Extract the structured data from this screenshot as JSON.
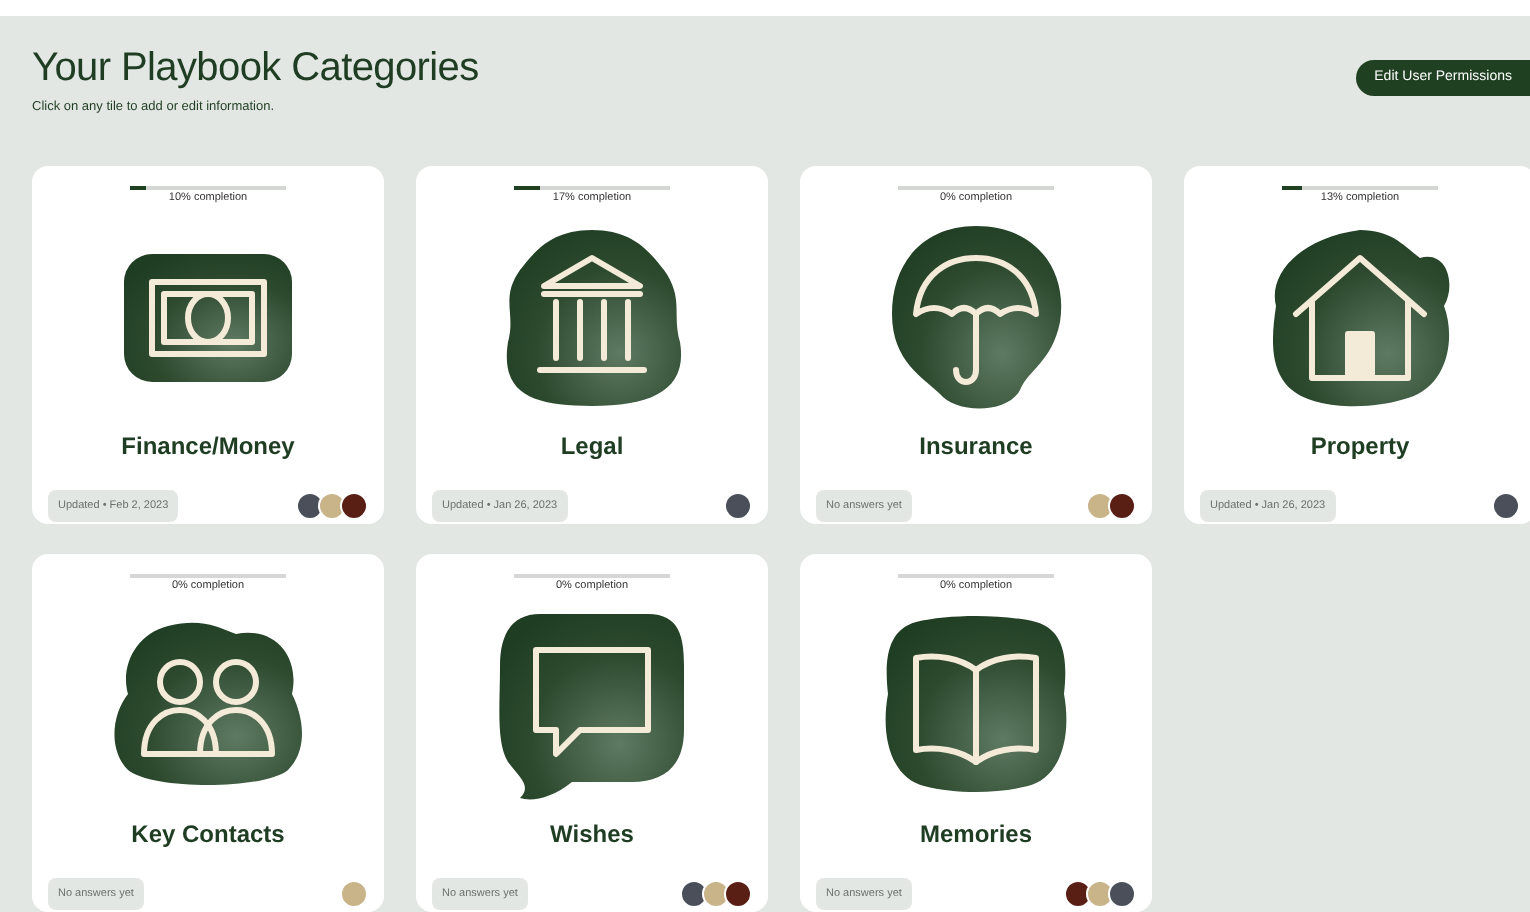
{
  "header": {
    "title": "Your Playbook Categories",
    "subtitle": "Click on any tile to add or edit information.",
    "button": "Edit User Permissions"
  },
  "categories": [
    {
      "kind": "money",
      "title": "Finance/Money",
      "level": 0.1,
      "completion": "10% completion",
      "footer": "Updated • Feb 2, 2023",
      "avatars": [
        {
          "color": "#4a4f5a"
        },
        {
          "color": "#c9b48a"
        },
        {
          "color": "#5a1f14"
        }
      ]
    },
    {
      "kind": "building",
      "title": "Legal",
      "level": 0.17,
      "completion": "17% completion",
      "footer": "Updated • Jan 26, 2023",
      "avatars": [
        {
          "color": "#4a4f5a"
        }
      ]
    },
    {
      "kind": "umbrella",
      "title": "Insurance",
      "level": 0,
      "completion": "0% completion",
      "footer": "No answers yet",
      "avatars": [
        {
          "color": "#c9b48a"
        },
        {
          "color": "#5a1f14"
        }
      ]
    },
    {
      "kind": "house",
      "title": "Property",
      "level": 0.13,
      "completion": "13% completion",
      "footer": "Updated • Jan 26, 2023",
      "avatars": [
        {
          "color": "#4a4f5a"
        }
      ]
    },
    {
      "kind": "people",
      "title": "Key Contacts",
      "level": 0,
      "completion": "0% completion",
      "footer": "No answers yet",
      "avatars": [
        {
          "color": "#c9b48a"
        }
      ]
    },
    {
      "kind": "speech",
      "title": "Wishes",
      "level": 0,
      "completion": "0% completion",
      "footer": "No answers yet",
      "avatars": [
        {
          "color": "#4a4f5a"
        },
        {
          "color": "#c9b48a"
        },
        {
          "color": "#5a1f14"
        }
      ]
    },
    {
      "kind": "book",
      "title": "Memories",
      "level": 0,
      "completion": "0% completion",
      "footer": "No answers yet",
      "avatars": [
        {
          "color": "#5a1f14"
        },
        {
          "color": "#c9b48a"
        },
        {
          "color": "#4a4f5a"
        }
      ]
    }
  ]
}
